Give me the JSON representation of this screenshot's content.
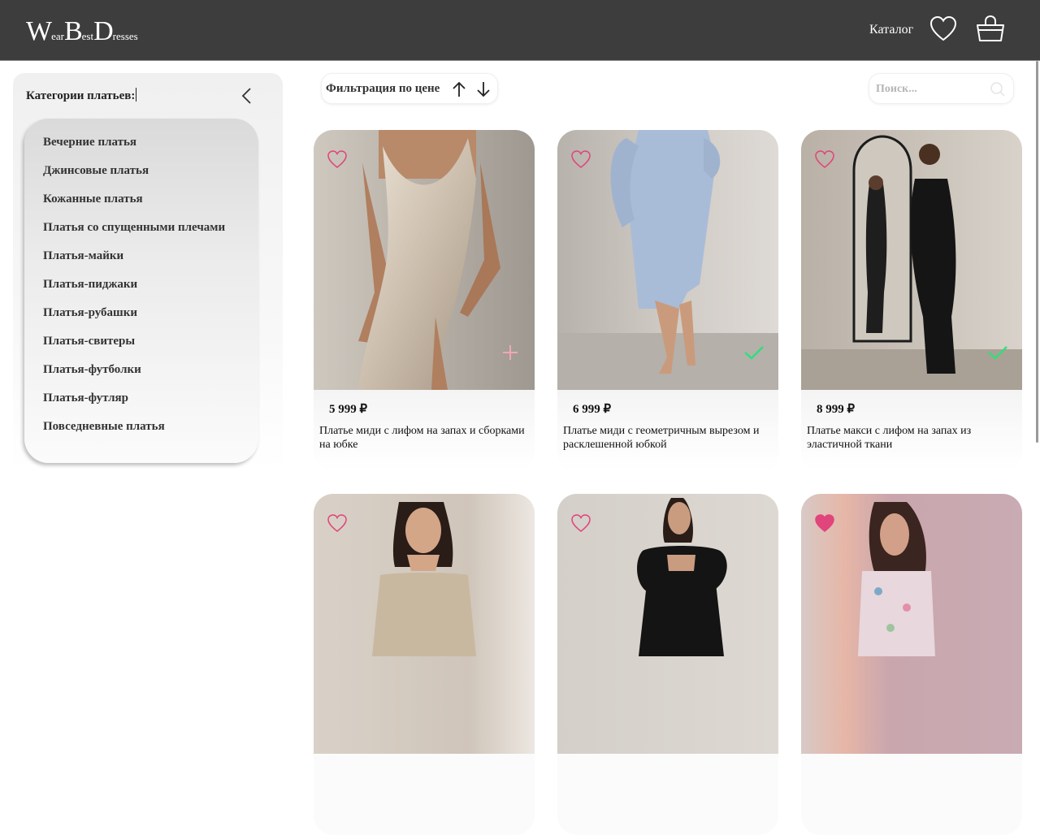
{
  "header": {
    "logo": {
      "w": "W",
      "w_rest": "ear",
      "b": "B",
      "b_rest": "est",
      "d": "D",
      "d_rest": "resses"
    },
    "nav_catalog": "Каталог",
    "favorites_icon": "heart-outline-icon",
    "cart_icon": "shopping-bag-icon"
  },
  "sidebar": {
    "title": "Категории платьев:",
    "collapse_icon": "chevron-left-icon",
    "categories": [
      "Вечерние платья",
      "Джинсовые платья",
      "Кожанные платья",
      "Платья со спущенными плечами",
      "Платья-майки",
      "Платья-пиджаки",
      "Платья-рубашки",
      "Платья-свитеры",
      "Платья-футболки",
      "Платья-футляр",
      "Повседневные платья"
    ]
  },
  "toolbar": {
    "filter_label": "Фильтрация по цене",
    "sort_asc_icon": "arrow-up-icon",
    "sort_desc_icon": "arrow-down-icon",
    "search_placeholder": "Поиск...",
    "search_icon": "search-icon"
  },
  "products": [
    {
      "price": "5 999 ₽",
      "name": "Платье миди с лифом на запах и сборками на юбке",
      "favorite": false,
      "in_cart": false
    },
    {
      "price": "6 999 ₽",
      "name": "Платье миди с геометричным вырезом и расклешенной юбкой",
      "favorite": false,
      "in_cart": true
    },
    {
      "price": "8 999 ₽",
      "name": "Платье макси с лифом на запах из эластичной ткани",
      "favorite": false,
      "in_cart": true
    },
    {
      "price": "",
      "name": "",
      "favorite": false,
      "in_cart": false
    },
    {
      "price": "",
      "name": "",
      "favorite": false,
      "in_cart": false
    },
    {
      "price": "",
      "name": "",
      "favorite": true,
      "in_cart": false
    }
  ],
  "colors": {
    "header_bg": "#3d3d3d",
    "heart_accent": "#e0457b",
    "add_icon": "#f2a6b8",
    "in_cart_check": "#2ee07a"
  }
}
